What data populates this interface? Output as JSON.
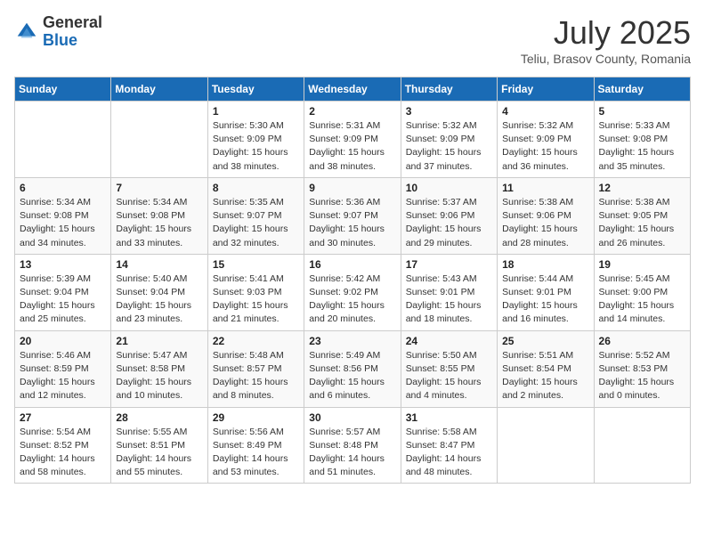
{
  "header": {
    "logo_general": "General",
    "logo_blue": "Blue",
    "month_title": "July 2025",
    "subtitle": "Teliu, Brasov County, Romania"
  },
  "days_of_week": [
    "Sunday",
    "Monday",
    "Tuesday",
    "Wednesday",
    "Thursday",
    "Friday",
    "Saturday"
  ],
  "weeks": [
    [
      {
        "day": "",
        "info": ""
      },
      {
        "day": "",
        "info": ""
      },
      {
        "day": "1",
        "info": "Sunrise: 5:30 AM\nSunset: 9:09 PM\nDaylight: 15 hours\nand 38 minutes."
      },
      {
        "day": "2",
        "info": "Sunrise: 5:31 AM\nSunset: 9:09 PM\nDaylight: 15 hours\nand 38 minutes."
      },
      {
        "day": "3",
        "info": "Sunrise: 5:32 AM\nSunset: 9:09 PM\nDaylight: 15 hours\nand 37 minutes."
      },
      {
        "day": "4",
        "info": "Sunrise: 5:32 AM\nSunset: 9:09 PM\nDaylight: 15 hours\nand 36 minutes."
      },
      {
        "day": "5",
        "info": "Sunrise: 5:33 AM\nSunset: 9:08 PM\nDaylight: 15 hours\nand 35 minutes."
      }
    ],
    [
      {
        "day": "6",
        "info": "Sunrise: 5:34 AM\nSunset: 9:08 PM\nDaylight: 15 hours\nand 34 minutes."
      },
      {
        "day": "7",
        "info": "Sunrise: 5:34 AM\nSunset: 9:08 PM\nDaylight: 15 hours\nand 33 minutes."
      },
      {
        "day": "8",
        "info": "Sunrise: 5:35 AM\nSunset: 9:07 PM\nDaylight: 15 hours\nand 32 minutes."
      },
      {
        "day": "9",
        "info": "Sunrise: 5:36 AM\nSunset: 9:07 PM\nDaylight: 15 hours\nand 30 minutes."
      },
      {
        "day": "10",
        "info": "Sunrise: 5:37 AM\nSunset: 9:06 PM\nDaylight: 15 hours\nand 29 minutes."
      },
      {
        "day": "11",
        "info": "Sunrise: 5:38 AM\nSunset: 9:06 PM\nDaylight: 15 hours\nand 28 minutes."
      },
      {
        "day": "12",
        "info": "Sunrise: 5:38 AM\nSunset: 9:05 PM\nDaylight: 15 hours\nand 26 minutes."
      }
    ],
    [
      {
        "day": "13",
        "info": "Sunrise: 5:39 AM\nSunset: 9:04 PM\nDaylight: 15 hours\nand 25 minutes."
      },
      {
        "day": "14",
        "info": "Sunrise: 5:40 AM\nSunset: 9:04 PM\nDaylight: 15 hours\nand 23 minutes."
      },
      {
        "day": "15",
        "info": "Sunrise: 5:41 AM\nSunset: 9:03 PM\nDaylight: 15 hours\nand 21 minutes."
      },
      {
        "day": "16",
        "info": "Sunrise: 5:42 AM\nSunset: 9:02 PM\nDaylight: 15 hours\nand 20 minutes."
      },
      {
        "day": "17",
        "info": "Sunrise: 5:43 AM\nSunset: 9:01 PM\nDaylight: 15 hours\nand 18 minutes."
      },
      {
        "day": "18",
        "info": "Sunrise: 5:44 AM\nSunset: 9:01 PM\nDaylight: 15 hours\nand 16 minutes."
      },
      {
        "day": "19",
        "info": "Sunrise: 5:45 AM\nSunset: 9:00 PM\nDaylight: 15 hours\nand 14 minutes."
      }
    ],
    [
      {
        "day": "20",
        "info": "Sunrise: 5:46 AM\nSunset: 8:59 PM\nDaylight: 15 hours\nand 12 minutes."
      },
      {
        "day": "21",
        "info": "Sunrise: 5:47 AM\nSunset: 8:58 PM\nDaylight: 15 hours\nand 10 minutes."
      },
      {
        "day": "22",
        "info": "Sunrise: 5:48 AM\nSunset: 8:57 PM\nDaylight: 15 hours\nand 8 minutes."
      },
      {
        "day": "23",
        "info": "Sunrise: 5:49 AM\nSunset: 8:56 PM\nDaylight: 15 hours\nand 6 minutes."
      },
      {
        "day": "24",
        "info": "Sunrise: 5:50 AM\nSunset: 8:55 PM\nDaylight: 15 hours\nand 4 minutes."
      },
      {
        "day": "25",
        "info": "Sunrise: 5:51 AM\nSunset: 8:54 PM\nDaylight: 15 hours\nand 2 minutes."
      },
      {
        "day": "26",
        "info": "Sunrise: 5:52 AM\nSunset: 8:53 PM\nDaylight: 15 hours\nand 0 minutes."
      }
    ],
    [
      {
        "day": "27",
        "info": "Sunrise: 5:54 AM\nSunset: 8:52 PM\nDaylight: 14 hours\nand 58 minutes."
      },
      {
        "day": "28",
        "info": "Sunrise: 5:55 AM\nSunset: 8:51 PM\nDaylight: 14 hours\nand 55 minutes."
      },
      {
        "day": "29",
        "info": "Sunrise: 5:56 AM\nSunset: 8:49 PM\nDaylight: 14 hours\nand 53 minutes."
      },
      {
        "day": "30",
        "info": "Sunrise: 5:57 AM\nSunset: 8:48 PM\nDaylight: 14 hours\nand 51 minutes."
      },
      {
        "day": "31",
        "info": "Sunrise: 5:58 AM\nSunset: 8:47 PM\nDaylight: 14 hours\nand 48 minutes."
      },
      {
        "day": "",
        "info": ""
      },
      {
        "day": "",
        "info": ""
      }
    ]
  ]
}
